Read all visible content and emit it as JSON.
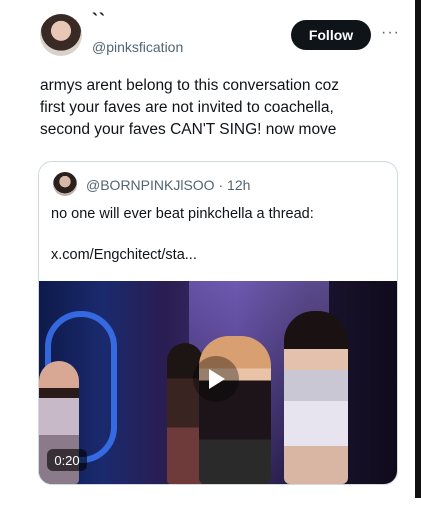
{
  "author": {
    "display_name": "``",
    "handle": "@pinksfication"
  },
  "follow_label": "Follow",
  "more_icon": "more-horizontal-icon",
  "tweet_lines": [
    "armys arent belong to this conversation coz",
    "first your faves are not invited to coachella,",
    "second your faves CAN'T SING! now move"
  ],
  "quote": {
    "handle": "@BORNPINKJlSOO",
    "separator": "·",
    "time": "12h",
    "text": "no one will ever beat pinkchella a thread:",
    "link": "x.com/Engchitect/sta...",
    "video": {
      "duration": "0:20",
      "play_icon": "play-icon"
    }
  },
  "colors": {
    "text": "#0f1419",
    "secondary": "#536471",
    "follow_bg": "#0f1419",
    "border": "#cfd9de"
  }
}
